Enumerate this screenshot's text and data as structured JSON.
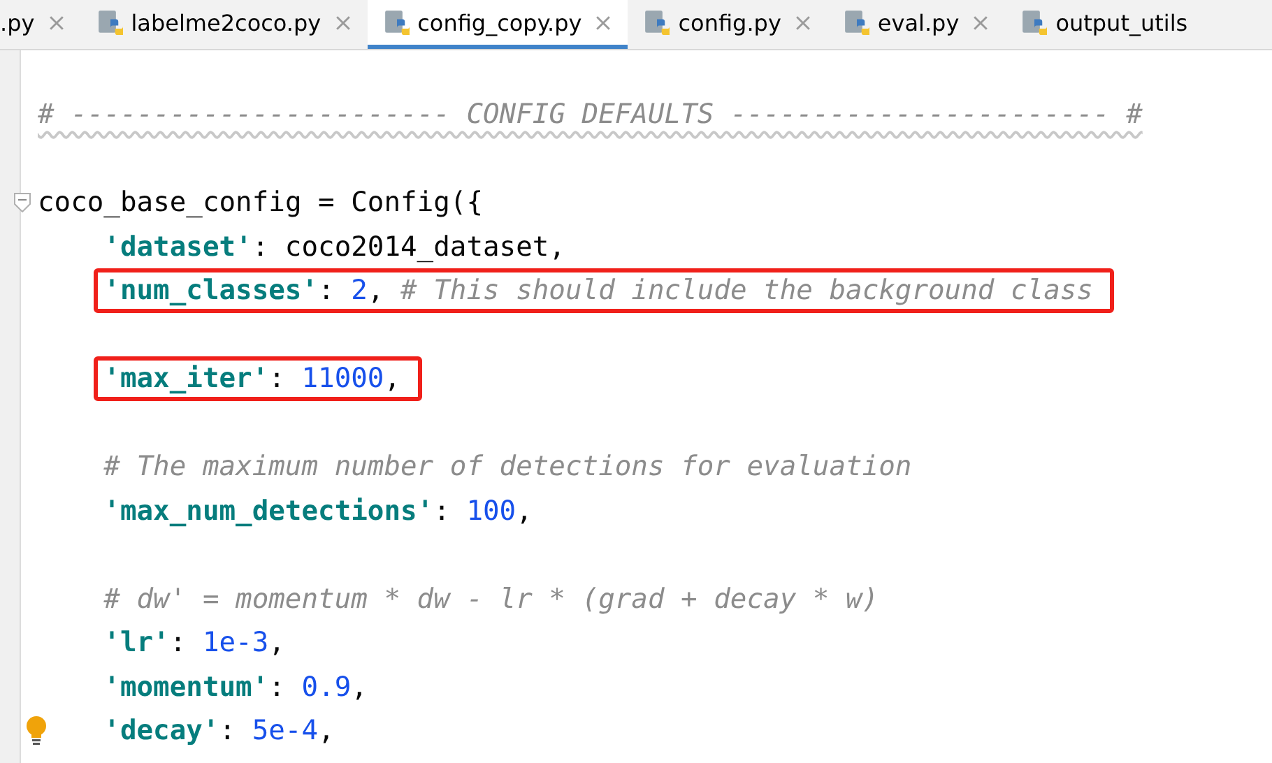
{
  "tabs": [
    {
      "label": ".py",
      "selected": false,
      "kind": "cut_start"
    },
    {
      "label": "labelme2coco.py",
      "selected": false,
      "kind": "full"
    },
    {
      "label": "config_copy.py",
      "selected": true,
      "kind": "full"
    },
    {
      "label": "config.py",
      "selected": false,
      "kind": "full"
    },
    {
      "label": "eval.py",
      "selected": false,
      "kind": "full"
    },
    {
      "label": "output_utils",
      "selected": false,
      "kind": "cut_end"
    }
  ],
  "editor": {
    "lines": [
      {
        "kind": "code",
        "underlined": true,
        "tokens": [
          {
            "kind": "comment",
            "text": "# ----------------------- CONFIG DEFAULTS ----------------------- #"
          }
        ]
      },
      {
        "kind": "blank"
      },
      {
        "kind": "code",
        "foldable": true,
        "tokens": [
          {
            "kind": "plain",
            "text": "coco_base_config = Config({"
          }
        ],
        "children": [
          {
            "kind": "code",
            "tokens": [
              {
                "kind": "string",
                "text": "'dataset'"
              },
              {
                "kind": "plain",
                "text": ": coco2014_dataset,"
              }
            ]
          },
          {
            "kind": "code",
            "boxed": true,
            "tokens": [
              {
                "kind": "string",
                "text": "'num_classes'"
              },
              {
                "kind": "plain",
                "text": ": "
              },
              {
                "kind": "number",
                "text": "2"
              },
              {
                "kind": "plain",
                "text": ", "
              },
              {
                "kind": "comment",
                "text": "# This should include the background class"
              }
            ]
          },
          {
            "kind": "blank"
          },
          {
            "kind": "code",
            "boxed": true,
            "tokens": [
              {
                "kind": "string",
                "text": "'max_iter'"
              },
              {
                "kind": "plain",
                "text": ": "
              },
              {
                "kind": "number",
                "text": "11000"
              },
              {
                "kind": "plain",
                "text": ","
              }
            ]
          },
          {
            "kind": "blank"
          },
          {
            "kind": "code",
            "tokens": [
              {
                "kind": "comment",
                "text": "# The maximum number of detections for evaluation"
              }
            ]
          },
          {
            "kind": "code",
            "tokens": [
              {
                "kind": "string",
                "text": "'max_num_detections'"
              },
              {
                "kind": "plain",
                "text": ": "
              },
              {
                "kind": "number",
                "text": "100"
              },
              {
                "kind": "plain",
                "text": ","
              }
            ]
          },
          {
            "kind": "blank"
          },
          {
            "kind": "code",
            "tokens": [
              {
                "kind": "comment",
                "text": "# dw' = momentum * dw - lr * (grad + decay * w)"
              }
            ]
          },
          {
            "kind": "code",
            "tokens": [
              {
                "kind": "string",
                "text": "'lr'"
              },
              {
                "kind": "plain",
                "text": ": "
              },
              {
                "kind": "number",
                "text": "1e-3"
              },
              {
                "kind": "plain",
                "text": ","
              }
            ]
          },
          {
            "kind": "code",
            "tokens": [
              {
                "kind": "string",
                "text": "'momentum'"
              },
              {
                "kind": "plain",
                "text": ": "
              },
              {
                "kind": "number",
                "text": "0.9"
              },
              {
                "kind": "plain",
                "text": ","
              }
            ]
          },
          {
            "kind": "code",
            "hint": true,
            "tokens": [
              {
                "kind": "string",
                "text": "'decay'"
              },
              {
                "kind": "plain",
                "text": ": "
              },
              {
                "kind": "number",
                "text": "5e-4"
              },
              {
                "kind": "plain",
                "text": ","
              }
            ]
          }
        ]
      }
    ]
  }
}
